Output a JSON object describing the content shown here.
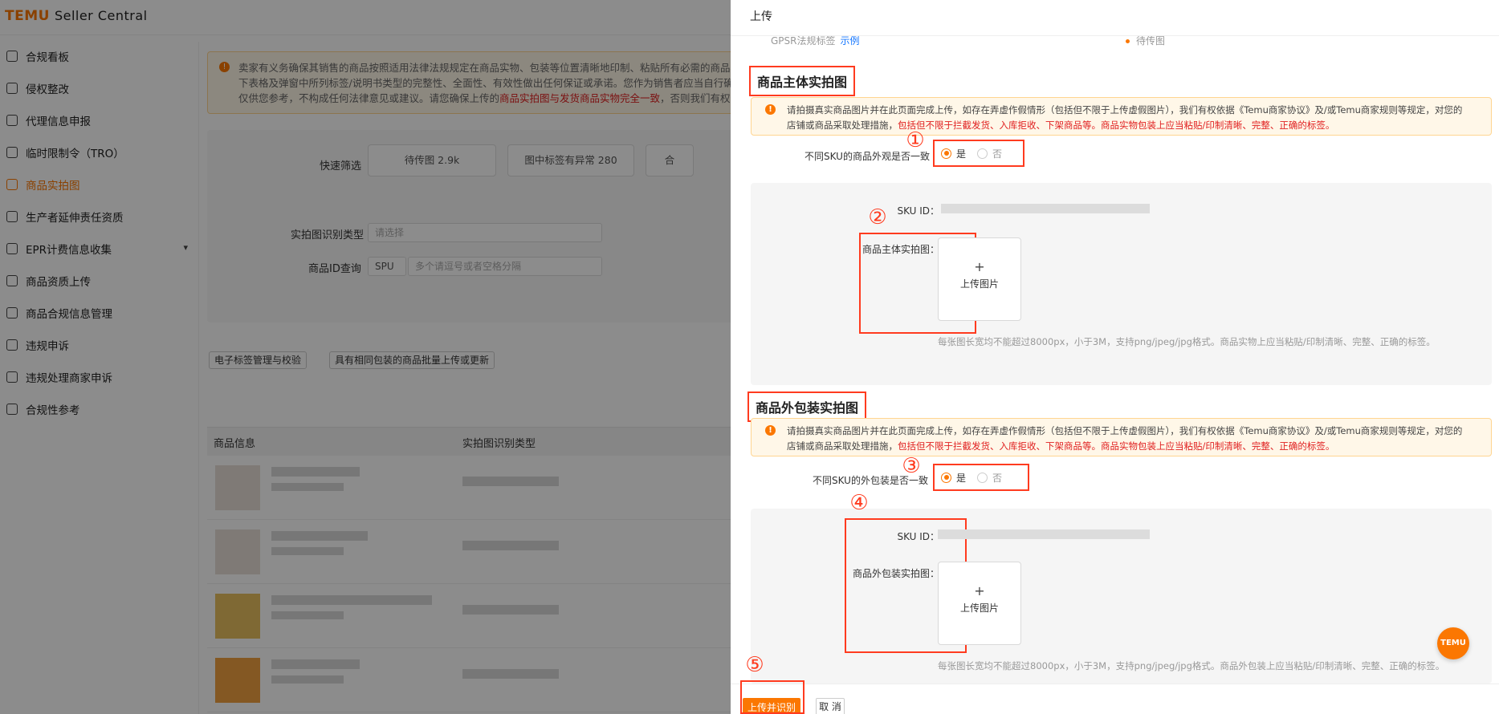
{
  "app": {
    "logo": "TEMU",
    "logo_sub": "Seller Central"
  },
  "sidebar": {
    "items": [
      {
        "label": "合规看板",
        "icon": "chart-icon"
      },
      {
        "label": "侵权整改",
        "icon": "alert-icon"
      },
      {
        "label": "代理信息申报",
        "icon": "user-icon"
      },
      {
        "label": "临时限制令（TRO）",
        "icon": "gavel-icon"
      },
      {
        "label": "商品实拍图",
        "icon": "image-icon",
        "active": true
      },
      {
        "label": "生产者延伸责任资质",
        "icon": "recycle-icon"
      },
      {
        "label": "EPR计费信息收集",
        "icon": "bill-icon",
        "has_children": true
      },
      {
        "label": "商品资质上传",
        "icon": "doc-icon"
      },
      {
        "label": "商品合规信息管理",
        "icon": "list-icon"
      },
      {
        "label": "违规申诉",
        "icon": "report-icon"
      },
      {
        "label": "违规处理商家申诉",
        "icon": "appeal-icon"
      },
      {
        "label": "合规性参考",
        "icon": "book-icon"
      }
    ]
  },
  "main": {
    "notice_line1": "卖家有义务确保其销售的商品按照适用法律法规规定在商品实物、包装等位置清晰地印制、粘贴所有必需的商品标签",
    "notice_line2": "下表格及弹窗中所列标签/说明书类型的完整性、全面性、有效性做出任何保证或承诺。您作为销售者应当自行确保商",
    "notice_line3a": "仅供您参考，不构成任何法律意见或建议。请您确保上传的",
    "notice_line3b": "商品实拍图与发货商品实物完全一致",
    "notice_line3c": "，否则我们有权依据",
    "quick_filter_label": "快速筛选",
    "chips": [
      "待传图 2.9k",
      "图中标签有异常 280",
      "合"
    ],
    "type_label": "实拍图识别类型",
    "type_placeholder": "请选择",
    "id_label": "商品ID查询",
    "id_select": "SPU",
    "id_placeholder": "多个请逗号或者空格分隔",
    "tag_btn": "电子标签管理与校验",
    "batch_btn": "具有相同包装的商品批量上传或更新",
    "col_product": "商品信息",
    "col_type": "实拍图识别类型"
  },
  "drawer": {
    "title": "上传",
    "gpsr_label": "GPSR法规标签",
    "gpsr_link": "示例",
    "gpsr_status": "待传图",
    "section1": {
      "title": "商品主体实拍图",
      "warn_a": "请拍摄真实商品图片并在此页面完成上传，如存在弄虚作假情形（包括但不限于上传虚假图片），我们有权依据《Temu商家协议》及/或Temu商家规则等规定，对您的",
      "warn_b": "店铺或商品采取处理措施，",
      "warn_c": "包括但不限于拦截发货、入库拒收、下架商品等。商品实物包装上应当粘贴/印制清晰、完整、正确的标签。",
      "question": "不同SKU的商品外观是否一致",
      "yes": "是",
      "no": "否",
      "sku_label": "SKU ID：",
      "img_label": "商品主体实拍图：",
      "upload_plus": "+",
      "upload_text": "上传图片",
      "hint": "每张图长宽均不能超过8000px，小于3M，支持png/jpeg/jpg格式。商品实物上应当粘贴/印制清晰、完整、正确的标签。"
    },
    "section2": {
      "title": "商品外包装实拍图",
      "warn_a": "请拍摄真实商品图片并在此页面完成上传，如存在弄虚作假情形（包括但不限于上传虚假图片），我们有权依据《Temu商家协议》及/或Temu商家规则等规定，对您的",
      "warn_b": "店铺或商品采取处理措施，",
      "warn_c": "包括但不限于拦截发货、入库拒收、下架商品等。商品实物包装上应当粘贴/印制清晰、完整、正确的标签。",
      "question": "不同SKU的外包装是否一致",
      "yes": "是",
      "no": "否",
      "sku_label": "SKU ID：",
      "img_label": "商品外包装实拍图：",
      "upload_plus": "+",
      "upload_text": "上传图片",
      "hint": "每张图长宽均不能超过8000px，小于3M，支持png/jpeg/jpg格式。商品外包装上应当粘贴/印制清晰、完整、正确的标签。"
    },
    "markers": [
      "①",
      "②",
      "③",
      "④",
      "⑤"
    ],
    "submit": "上传并识别",
    "cancel": "取 消",
    "fab": "TEMU"
  },
  "colors": {
    "brand": "#fb7701",
    "annotation": "#ff3b1f",
    "warning_text": "#e02020"
  }
}
